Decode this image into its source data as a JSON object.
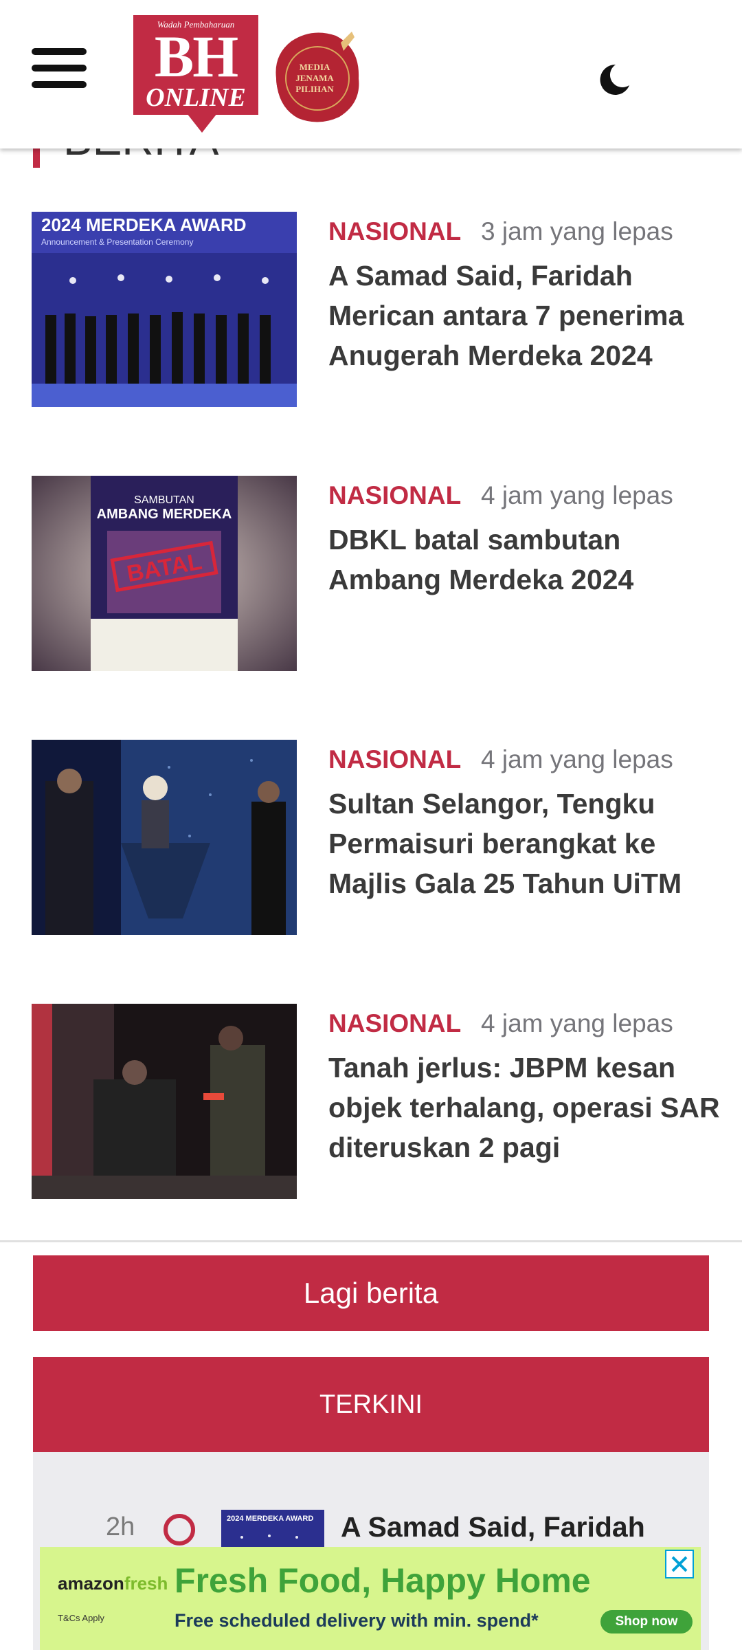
{
  "header": {
    "logo_tagline": "Wadah Pembaharuan",
    "logo_text": "BH",
    "logo_subtext": "ONLINE",
    "award_text": [
      "MEDIA",
      "JENAMA",
      "PILIHAN"
    ]
  },
  "section": {
    "title": "BERITA"
  },
  "articles": [
    {
      "category": "NASIONAL",
      "time": "3 jam yang lepas",
      "title": "A Samad Said, Faridah Merican antara 7 penerima Anugerah Merdeka 2024"
    },
    {
      "category": "NASIONAL",
      "time": "4 jam yang lepas",
      "title": "DBKL batal sambutan Ambang Merdeka 2024"
    },
    {
      "category": "NASIONAL",
      "time": "4 jam yang lepas",
      "title": "Sultan Selangor, Tengku Permaisuri berangkat ke Majlis Gala 25 Tahun UiTM"
    },
    {
      "category": "NASIONAL",
      "time": "4 jam yang lepas",
      "title": "Tanah jerlus: JBPM kesan objek terhalang, operasi SAR diteruskan 2 pagi"
    }
  ],
  "more_button": "Lagi berita",
  "terkini": {
    "label": "TERKINI",
    "items": [
      {
        "time": "2h",
        "title": "A Samad Said, Faridah"
      }
    ]
  },
  "ad": {
    "brand_a": "amazon",
    "brand_b": "fresh",
    "headline": "Fresh Food, Happy Home",
    "subline": "Free scheduled delivery with min. spend*",
    "cta": "Shop now",
    "small_print": "T&Cs Apply"
  },
  "colors": {
    "brand": "#c12b44",
    "ad_bg": "#d7f58d",
    "ad_green": "#3fa33a"
  }
}
